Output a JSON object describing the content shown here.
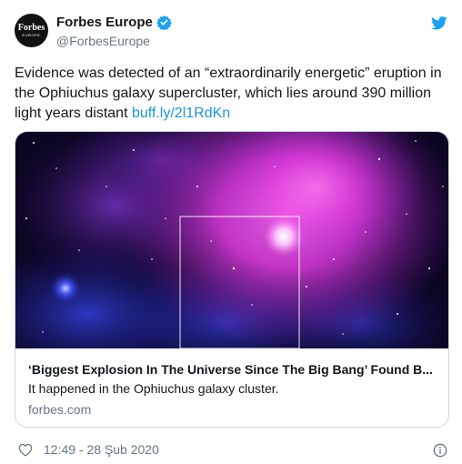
{
  "author": {
    "avatar_line1": "Forbes",
    "avatar_line2": "EUROPE",
    "display_name": "Forbes Europe",
    "handle": "@ForbesEurope",
    "verified": true
  },
  "tweet": {
    "text": "Evidence was detected of an “extraordinarily energetic” eruption in the Ophiuchus galaxy supercluster, which lies around 390 million light years distant ",
    "link_text": "buff.ly/2l1RdKn"
  },
  "card": {
    "image_icon": "galaxy-cluster-image",
    "title": "‘Biggest Explosion In The Universe Since The Big Bang’ Found B...",
    "description": "It happened in the Ophiuchus galaxy cluster.",
    "domain": "forbes.com"
  },
  "footer": {
    "timestamp": "12:49 - 28 Şub 2020",
    "like_icon": "heart-icon",
    "info_icon": "info-icon"
  },
  "colors": {
    "link": "#1b95e0",
    "secondary_text": "#657786",
    "twitter_blue": "#1da1f2",
    "border": "#ccd6dd"
  }
}
